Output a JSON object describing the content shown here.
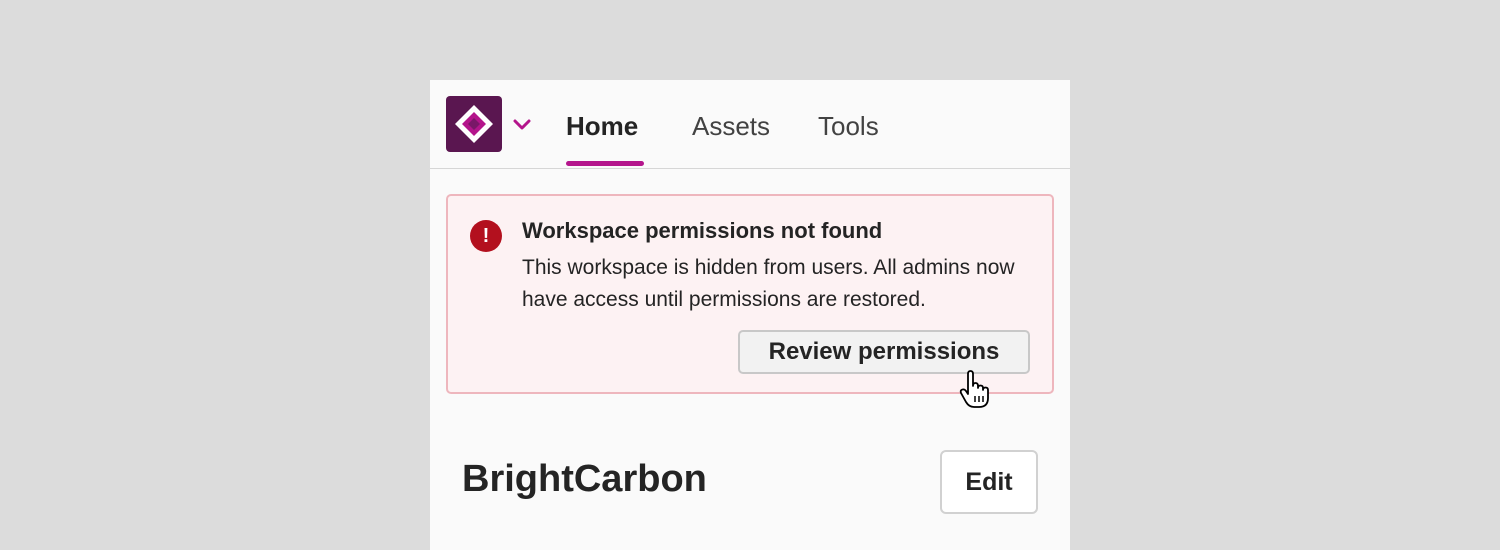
{
  "nav": {
    "tabs": [
      {
        "label": "Home",
        "active": true
      },
      {
        "label": "Assets",
        "active": false
      },
      {
        "label": "Tools",
        "active": false
      }
    ],
    "accent_color": "#b4158c",
    "logo_color": "#5a1650"
  },
  "alert": {
    "icon": "error-icon",
    "title": "Workspace permissions not found",
    "body": "This workspace is hidden from users. All admins now have access until permissions are restored.",
    "action_label": "Review permissions",
    "color": "#b3101e"
  },
  "workspace": {
    "name": "BrightCarbon",
    "edit_label": "Edit"
  }
}
